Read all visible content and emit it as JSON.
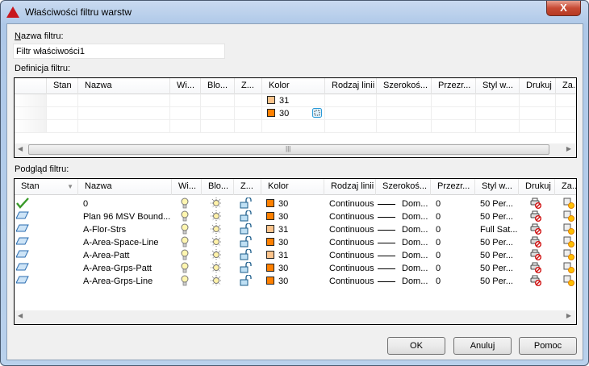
{
  "window": {
    "title": "Właściwości filtru warstw",
    "close_label": "X"
  },
  "filter_name": {
    "label": "Nazwa filtru:",
    "mnemonic": "N",
    "label_rest": "azwa filtru:",
    "value": "Filtr właściwości1"
  },
  "definition": {
    "label": "Definicja filtru:",
    "columns": [
      "Stan",
      "Nazwa",
      "Wi...",
      "Blo...",
      "Z...",
      "Kolor",
      "Rodzaj linii",
      "Szerokoś...",
      "Przezr...",
      "Styl w...",
      "Drukuj",
      "Za..."
    ],
    "rows": [
      {
        "color": "31",
        "swatch": "#fcc48c"
      },
      {
        "color": "30",
        "swatch": "#ff8000",
        "editing": true
      },
      {}
    ]
  },
  "preview": {
    "label": "Podgląd filtru:",
    "columns": [
      "Stan",
      "Nazwa",
      "Wi...",
      "Blo...",
      "Z...",
      "Kolor",
      "Rodzaj linii",
      "Szerokoś...",
      "Przezr...",
      "Styl w...",
      "Drukuj",
      "Za..."
    ],
    "sort_column": "Stan",
    "rows": [
      {
        "status": "current",
        "name": "0",
        "color": "30",
        "swatch": "#ff8000",
        "linetype": "Continuous",
        "lineweight": "Dom...",
        "transparency": "0",
        "plot_style": "50 Per..."
      },
      {
        "status": "layer",
        "name": "Plan 96 MSV Bound...",
        "color": "30",
        "swatch": "#ff8000",
        "linetype": "Continuous",
        "lineweight": "Dom...",
        "transparency": "0",
        "plot_style": "50 Per..."
      },
      {
        "status": "layer",
        "name": "A-Flor-Strs",
        "color": "31",
        "swatch": "#fcc48c",
        "linetype": "Continuous",
        "lineweight": "Dom...",
        "transparency": "0",
        "plot_style": "Full Sat..."
      },
      {
        "status": "layer",
        "name": "A-Area-Space-Line",
        "color": "30",
        "swatch": "#ff8000",
        "linetype": "Continuous",
        "lineweight": "Dom...",
        "transparency": "0",
        "plot_style": "50 Per..."
      },
      {
        "status": "layer",
        "name": "A-Area-Patt",
        "color": "31",
        "swatch": "#fcc48c",
        "linetype": "Continuous",
        "lineweight": "Dom...",
        "transparency": "0",
        "plot_style": "50 Per..."
      },
      {
        "status": "layer",
        "name": "A-Area-Grps-Patt",
        "color": "30",
        "swatch": "#ff8000",
        "linetype": "Continuous",
        "lineweight": "Dom...",
        "transparency": "0",
        "plot_style": "50 Per..."
      },
      {
        "status": "layer",
        "name": "A-Area-Grps-Line",
        "color": "30",
        "swatch": "#ff8000",
        "linetype": "Continuous",
        "lineweight": "Dom...",
        "transparency": "0",
        "plot_style": "50 Per..."
      }
    ]
  },
  "buttons": {
    "ok": "OK",
    "cancel": "Anuluj",
    "help": "Pomoc"
  }
}
